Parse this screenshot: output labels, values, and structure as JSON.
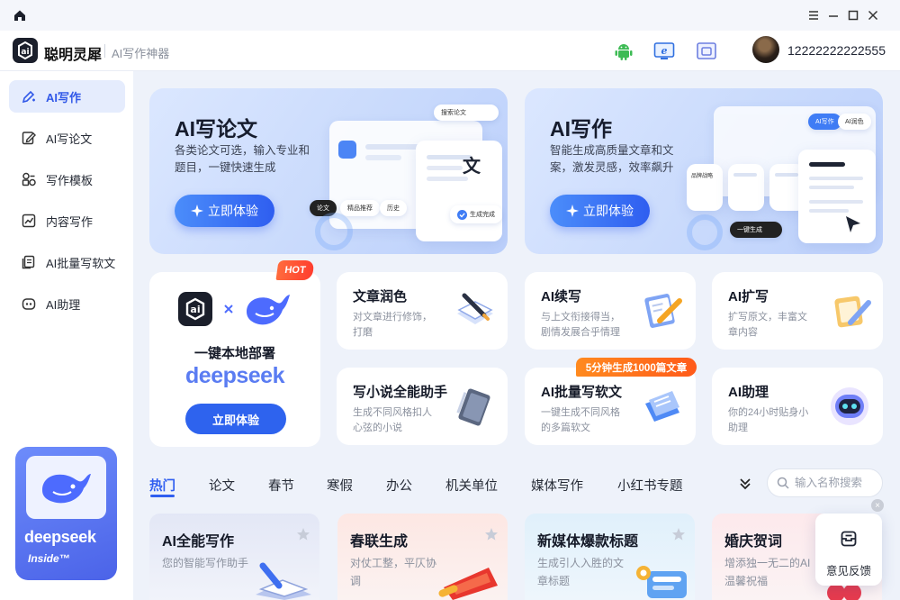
{
  "app": {
    "name": "聪明灵犀",
    "subtitle": "AI写作神器",
    "user_id": "12222222222555"
  },
  "sidebar": {
    "items": [
      {
        "label": "AI写作",
        "icon": "pen-spark-icon",
        "active": true
      },
      {
        "label": "AI写论文",
        "icon": "edit-document-icon",
        "active": false
      },
      {
        "label": "写作模板",
        "icon": "template-icon",
        "active": false
      },
      {
        "label": "内容写作",
        "icon": "chart-document-icon",
        "active": false
      },
      {
        "label": "AI批量写软文",
        "icon": "batch-document-icon",
        "active": false
      },
      {
        "label": "AI助理",
        "icon": "robot-icon",
        "active": false
      }
    ]
  },
  "promo": {
    "brand": "deepseek",
    "tagline": "Inside™"
  },
  "hero": [
    {
      "title": "AI写论文",
      "desc": "各类论文可选，输入专业和题目，一键快速生成",
      "button": "立即体验",
      "mock": {
        "search": "搜索论文",
        "char": "文",
        "chips": [
          "论文",
          "精品推荐",
          "历史"
        ],
        "done": "生成完成"
      }
    },
    {
      "title": "AI写作",
      "desc": "智能生成高质量文章和文案，激发灵感，效率飙升",
      "button": "立即体验",
      "mock": {
        "chips": [
          "AI写作",
          "AI润色"
        ],
        "card": "品牌战略",
        "gen": "一键生成"
      }
    }
  ],
  "deepseek_card": {
    "badge": "HOT",
    "tagline": "一键本地部署",
    "brand": "deepseek",
    "button": "立即体验"
  },
  "tool_cards": [
    {
      "title": "文章润色",
      "desc": "对文章进行修饰，打磨"
    },
    {
      "title": "AI续写",
      "desc": "与上文衔接得当，剧情发展合乎情理"
    },
    {
      "title": "AI扩写",
      "desc": "扩写原文，丰富文章内容"
    },
    {
      "title": "写小说全能助手",
      "desc": "生成不同风格扣人心弦的小说"
    },
    {
      "title": "AI批量写软文",
      "desc": "一键生成不同风格的多篇软文"
    },
    {
      "title": "AI助理",
      "desc": "你的24小时贴身小助理"
    }
  ],
  "batch_badge": "5分钟生成1000篇文章",
  "tabs": [
    "热门",
    "论文",
    "春节",
    "寒假",
    "办公",
    "机关单位",
    "媒体写作",
    "小红书专题"
  ],
  "search": {
    "placeholder": "输入名称搜索"
  },
  "template_cards": [
    {
      "title": "AI全能写作",
      "desc": "您的智能写作助手"
    },
    {
      "title": "春联生成",
      "desc": "对仗工整，平仄协调"
    },
    {
      "title": "新媒体爆款标题",
      "desc": "生成引人入胜的文章标题"
    },
    {
      "title": "婚庆贺词",
      "desc": "增添独一无二的AI温馨祝福"
    }
  ],
  "feedback": {
    "label": "意见反馈"
  },
  "colors": {
    "accent": "#2f5ef0",
    "hot": "#ff4a2e",
    "badge": "#ff6f1c",
    "sidebar_active_bg": "#e5ecfd"
  }
}
